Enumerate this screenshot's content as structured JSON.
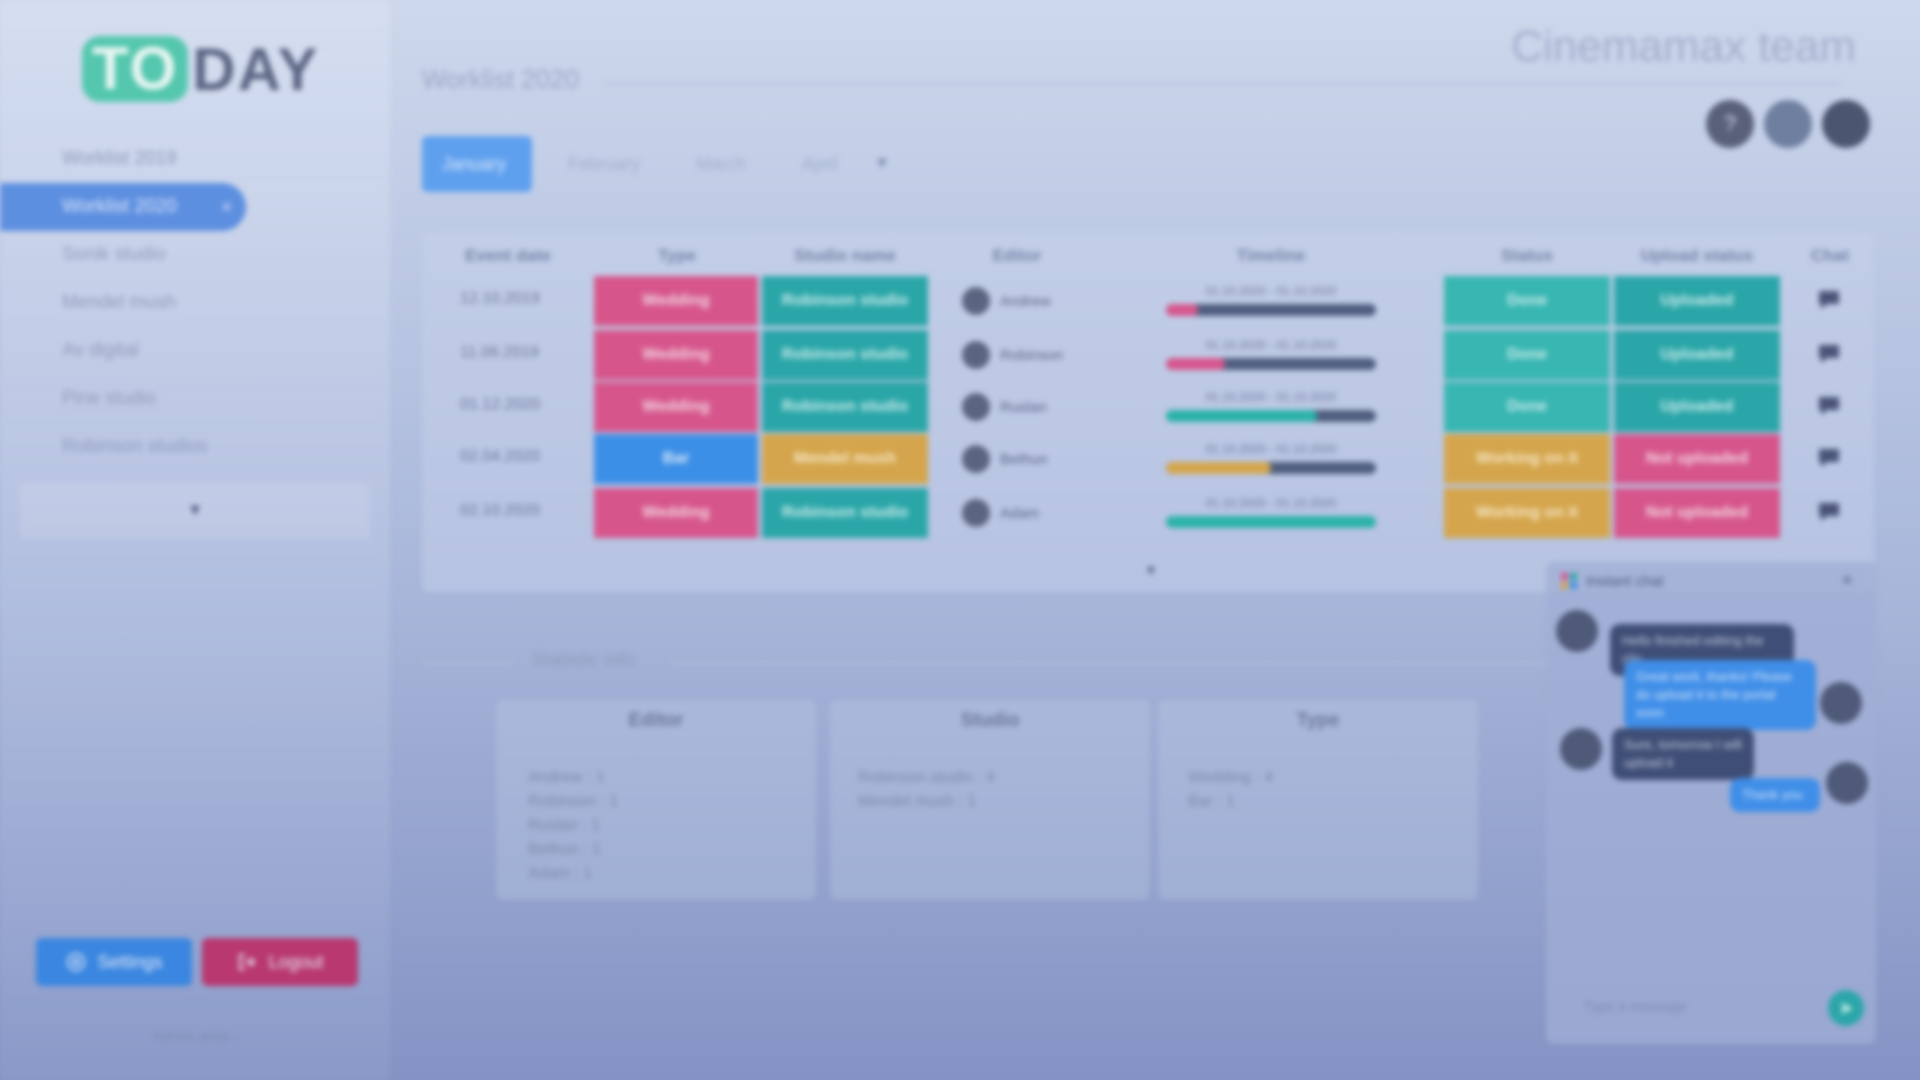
{
  "logo": {
    "part1": "TO",
    "part2": "DAY"
  },
  "sidebar": {
    "items": [
      {
        "label": "Worklist 2019"
      },
      {
        "label": "Worklist 2020",
        "close": "×"
      },
      {
        "label": "Sonik studio"
      },
      {
        "label": "Mendel mush"
      },
      {
        "label": "Av digital"
      },
      {
        "label": "Pine studio"
      },
      {
        "label": "Robinson studios"
      }
    ],
    "more": "▼",
    "settings_label": "Settings",
    "logout_label": "Logout",
    "footer": "Admin area ›"
  },
  "header": {
    "team": "Cinemamax team",
    "page_title": "Worklist 2020",
    "avatars": [
      "?",
      "",
      ""
    ]
  },
  "tabs": [
    "January",
    "February",
    "March",
    "April"
  ],
  "tabs_more": "▼",
  "table": {
    "columns": [
      "Event date",
      "Type",
      "Studio name",
      "Editor",
      "Timeline",
      "Status",
      "Upload status",
      "Chat"
    ],
    "rows": [
      {
        "date": "12.10.2019",
        "type": "Wedding",
        "studio": "Robinson studio",
        "editor": "Andrew",
        "timeline": "01.10.2020 - 01.10.2020",
        "progress": 0.15,
        "status": "Done",
        "upload": "Uploaded"
      },
      {
        "date": "11.06.2019",
        "type": "Wedding",
        "studio": "Robinson studio",
        "editor": "Robinson",
        "timeline": "01.10.2020 - 01.10.2020",
        "progress": 0.28,
        "status": "Done",
        "upload": "Uploaded"
      },
      {
        "date": "01.12.2020",
        "type": "Wedding",
        "studio": "Robinson studio",
        "editor": "Ruslan",
        "timeline": "01.10.2020 - 01.10.2020",
        "progress": 0.72,
        "status": "Done",
        "upload": "Uploaded"
      },
      {
        "date": "02.04.2020",
        "type": "Bar",
        "studio": "Mendel mush",
        "editor": "Bethun",
        "timeline": "01.10.2020 - 01.10.2020",
        "progress": 0.5,
        "status": "Working on it",
        "upload": "Not uploaded"
      },
      {
        "date": "02.10.2020",
        "type": "Wedding",
        "studio": "Robinson studio",
        "editor": "Adam",
        "timeline": "01.10.2020 - 01.10.2020",
        "progress": 1.0,
        "status": "Working on it",
        "upload": "Not uploaded"
      }
    ],
    "scroll": "▼"
  },
  "stats": {
    "title": "Statistic info",
    "cards": [
      {
        "title": "Editor",
        "lines": [
          "Andrew : 1",
          "Robinson : 1",
          "Ruslan : 1",
          "Bethun : 1",
          "Adam : 1"
        ]
      },
      {
        "title": "Studio",
        "lines": [
          "Robinson studio : 4",
          "Mendel mush : 1"
        ]
      },
      {
        "title": "Type",
        "lines": [
          "Wedding : 4",
          "Bar : 1"
        ]
      }
    ]
  },
  "chat": {
    "title": "Instant chat",
    "close": "×",
    "messages": [
      {
        "dir": "in",
        "text": "Hello finished editing the clip"
      },
      {
        "dir": "out",
        "text": "Great work, thanks! Please do upload it to the portal soon"
      },
      {
        "dir": "in",
        "text": "Sure, tomorrow I will upload it"
      },
      {
        "dir": "out",
        "text": "Thank you"
      }
    ],
    "input_placeholder": "Type a message",
    "send": "➤"
  },
  "colors": {
    "pink": "#d6568c",
    "teal": "#2aa6a8",
    "blue": "#3c8fe6",
    "gold": "#d4a54c",
    "bar_pink": "#d6568c",
    "bar_teal": "#2bb2a8",
    "bar_gold": "#d4a54c"
  }
}
